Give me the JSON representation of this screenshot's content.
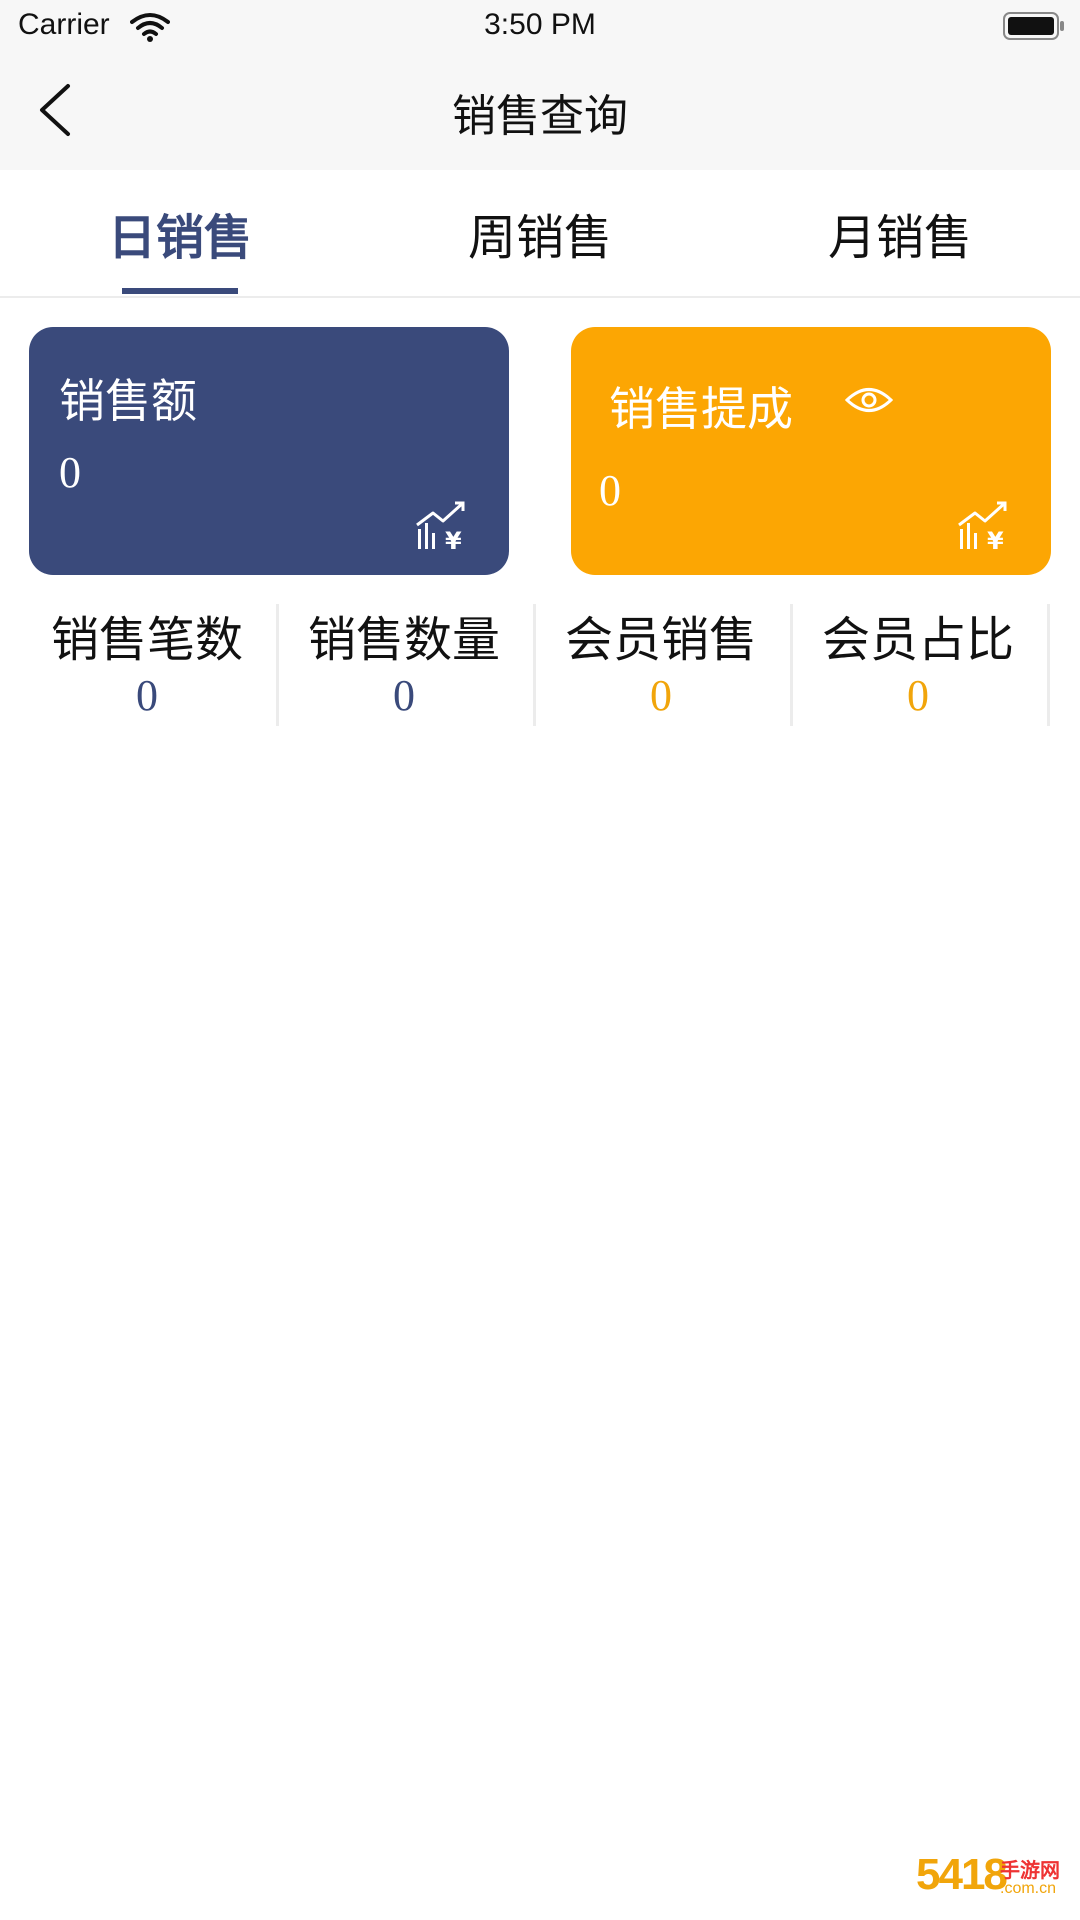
{
  "status_bar": {
    "carrier": "Carrier",
    "time": "3:50 PM",
    "wifi_icon": "wifi-icon",
    "battery_icon": "battery-full-icon"
  },
  "nav": {
    "back_icon": "chevron-left-icon",
    "title": "销售查询"
  },
  "tabs": [
    {
      "label": "日销售",
      "active": true
    },
    {
      "label": "周销售",
      "active": false
    },
    {
      "label": "月销售",
      "active": false
    }
  ],
  "cards": {
    "sales_amount": {
      "label": "销售额",
      "value": "0",
      "icon": "sales-trend-icon",
      "color": "#3a4a7b"
    },
    "commission": {
      "label": "销售提成",
      "value": "0",
      "eye_icon": "eye-icon",
      "icon": "sales-trend-icon",
      "color": "#fca603"
    }
  },
  "stats": [
    {
      "label": "销售笔数",
      "value": "0",
      "color": "#3a4a7b"
    },
    {
      "label": "销售数量",
      "value": "0",
      "color": "#3a4a7b"
    },
    {
      "label": "会员销售",
      "value": "0",
      "color": "#f1a50b"
    },
    {
      "label": "会员占比",
      "value": "0",
      "color": "#f1a50b"
    }
  ],
  "watermark": {
    "mark": "5418",
    "text": "手游网",
    "sub": ".com.cn"
  }
}
